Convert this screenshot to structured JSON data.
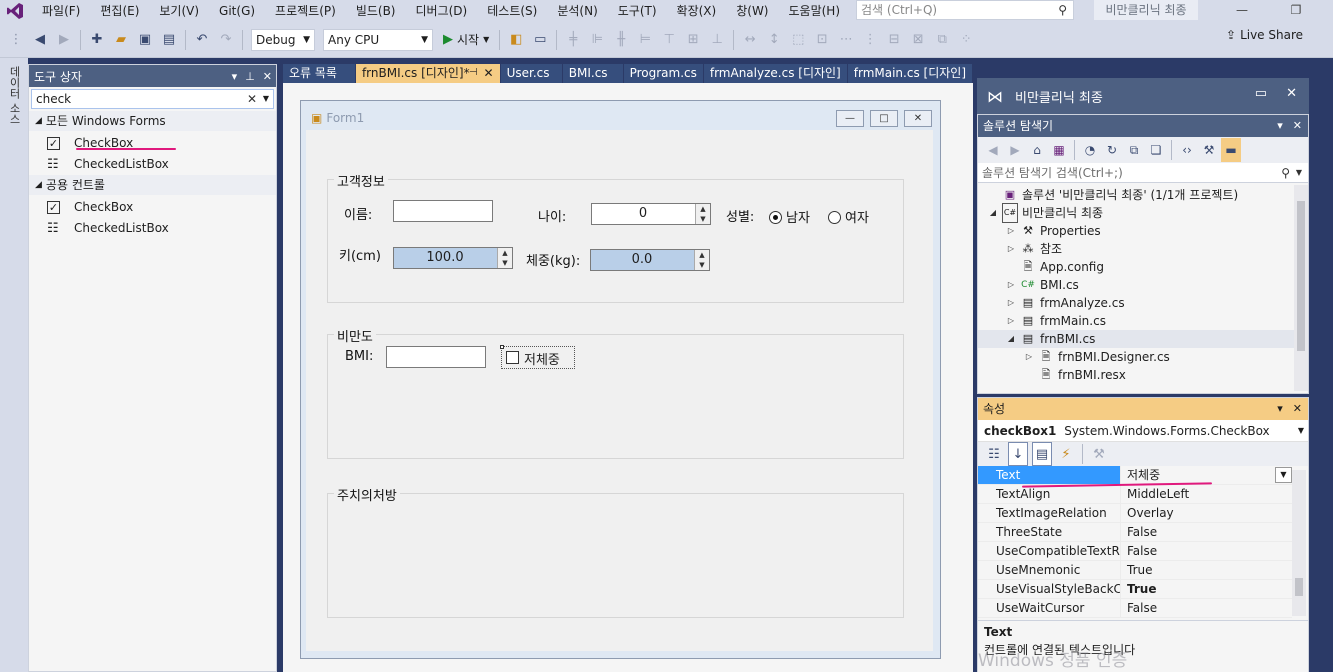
{
  "menu": {
    "items": [
      "파일(F)",
      "편집(E)",
      "보기(V)",
      "Git(G)",
      "프로젝트(P)",
      "빌드(B)",
      "디버그(D)",
      "테스트(S)",
      "분석(N)",
      "도구(T)",
      "확장(X)",
      "창(W)",
      "도움말(H)"
    ],
    "search_placeholder": "검색 (Ctrl+Q)",
    "solution_name": "비만클리닉 최종"
  },
  "toolbar": {
    "config": "Debug",
    "platform": "Any CPU",
    "start_label": "시작",
    "live_share": "Live Share"
  },
  "sidestrip": {
    "label": "데이터 소스"
  },
  "toolbox": {
    "title": "도구 상자",
    "search_value": "check",
    "groups": [
      {
        "name": "모든 Windows Forms",
        "items": [
          "CheckBox",
          "CheckedListBox"
        ]
      },
      {
        "name": "공용 컨트롤",
        "items": [
          "CheckBox",
          "CheckedListBox"
        ]
      }
    ]
  },
  "tabs": [
    "오류 목록",
    "frnBMI.cs [디자인]*",
    "User.cs",
    "BMI.cs",
    "Program.cs",
    "frmAnalyze.cs [디자인]",
    "frmMain.cs [디자인]"
  ],
  "form": {
    "title": "Form1",
    "group1": "고객정보",
    "name_label": "이름:",
    "age_label": "나이:",
    "age_value": "0",
    "gender_label": "성별:",
    "male": "남자",
    "female": "여자",
    "height_label": "키(cm)",
    "height_value": "100.0",
    "weight_label": "체중(kg):",
    "weight_value": "0.0",
    "group2": "비만도",
    "bmi_label": "BMI:",
    "checkbox_label": "저체중",
    "group3": "주치의처방"
  },
  "vs_panel": {
    "title": "비만클리닉 최종"
  },
  "solution_explorer": {
    "title": "솔루션 탐색기",
    "search_placeholder": "솔루션 탐색기 검색(Ctrl+;)",
    "nodes": [
      {
        "label": "솔루션 '비만클리닉 최종' (1/1개 프로젝트)",
        "icon": "solution-icon"
      },
      {
        "label": "비만클리닉 최종",
        "icon": "csproj-icon"
      },
      {
        "label": "Properties",
        "icon": "wrench-icon"
      },
      {
        "label": "참조",
        "icon": "references-icon"
      },
      {
        "label": "App.config",
        "icon": "config-file-icon"
      },
      {
        "label": "BMI.cs",
        "icon": "csharp-file-icon"
      },
      {
        "label": "frmAnalyze.cs",
        "icon": "form-file-icon"
      },
      {
        "label": "frmMain.cs",
        "icon": "form-file-icon"
      },
      {
        "label": "frnBMI.cs",
        "icon": "form-file-icon"
      },
      {
        "label": "frnBMI.Designer.cs",
        "icon": "csharp-file-icon"
      },
      {
        "label": "frnBMI.resx",
        "icon": "resx-file-icon"
      }
    ]
  },
  "properties": {
    "title": "속성",
    "object_name": "checkBox1",
    "object_type": "System.Windows.Forms.CheckBox",
    "rows": [
      {
        "name": "Text",
        "value": "저체중"
      },
      {
        "name": "TextAlign",
        "value": "MiddleLeft"
      },
      {
        "name": "TextImageRelation",
        "value": "Overlay"
      },
      {
        "name": "ThreeState",
        "value": "False"
      },
      {
        "name": "UseCompatibleTextRender",
        "value": "False"
      },
      {
        "name": "UseMnemonic",
        "value": "True"
      },
      {
        "name": "UseVisualStyleBackColor",
        "value": "True"
      },
      {
        "name": "UseWaitCursor",
        "value": "False"
      }
    ],
    "desc_title": "Text",
    "desc_text": "컨트롤에 연결된 텍스트입니다"
  },
  "watermark": "Windows 정품 인증",
  "colors": {
    "accent": "#4d6082",
    "active_tab": "#f5cc84",
    "selection": "#3399ff",
    "annotation": "#e0197d"
  }
}
